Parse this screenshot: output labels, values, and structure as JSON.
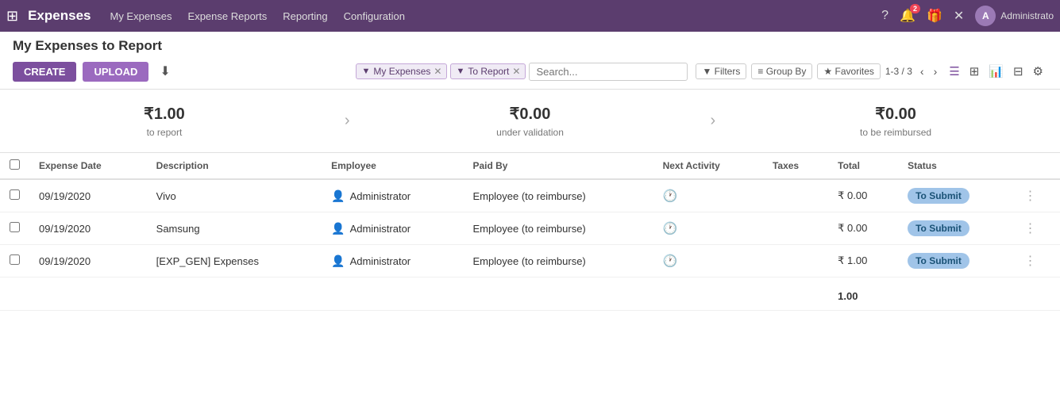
{
  "topnav": {
    "brand": "Expenses",
    "menu": [
      "My Expenses",
      "Expense Reports",
      "Reporting",
      "Configuration"
    ],
    "notification_count": "2",
    "user_name": "Administrato"
  },
  "page": {
    "title": "My Expenses to Report"
  },
  "toolbar": {
    "create_label": "CREATE",
    "upload_label": "UPLOAD",
    "download_icon": "⬇"
  },
  "filters": {
    "chip1_label": "My Expenses",
    "chip2_label": "To Report",
    "search_placeholder": "Search..."
  },
  "view_controls": {
    "filter_label": "Filters",
    "groupby_label": "Group By",
    "favorites_label": "Favorites",
    "pagination": "1-3 / 3"
  },
  "summary": {
    "amount1": "₹1.00",
    "label1": "to report",
    "amount2": "₹0.00",
    "label2": "under validation",
    "amount3": "₹0.00",
    "label3": "to be reimbursed"
  },
  "table": {
    "headers": [
      "Expense Date",
      "Description",
      "Employee",
      "Paid By",
      "Next Activity",
      "Taxes",
      "Total",
      "Status"
    ],
    "rows": [
      {
        "date": "09/19/2020",
        "description": "Vivo",
        "employee": "Administrator",
        "paid_by": "Employee (to reimburse)",
        "next_activity": "",
        "taxes": "",
        "total": "₹ 0.00",
        "status": "To Submit"
      },
      {
        "date": "09/19/2020",
        "description": "Samsung",
        "employee": "Administrator",
        "paid_by": "Employee (to reimburse)",
        "next_activity": "",
        "taxes": "",
        "total": "₹ 0.00",
        "status": "To Submit"
      },
      {
        "date": "09/19/2020",
        "description": "[EXP_GEN] Expenses",
        "employee": "Administrator",
        "paid_by": "Employee (to reimburse)",
        "next_activity": "",
        "taxes": "",
        "total": "₹ 1.00",
        "status": "To Submit"
      }
    ],
    "footer_total": "1.00"
  }
}
